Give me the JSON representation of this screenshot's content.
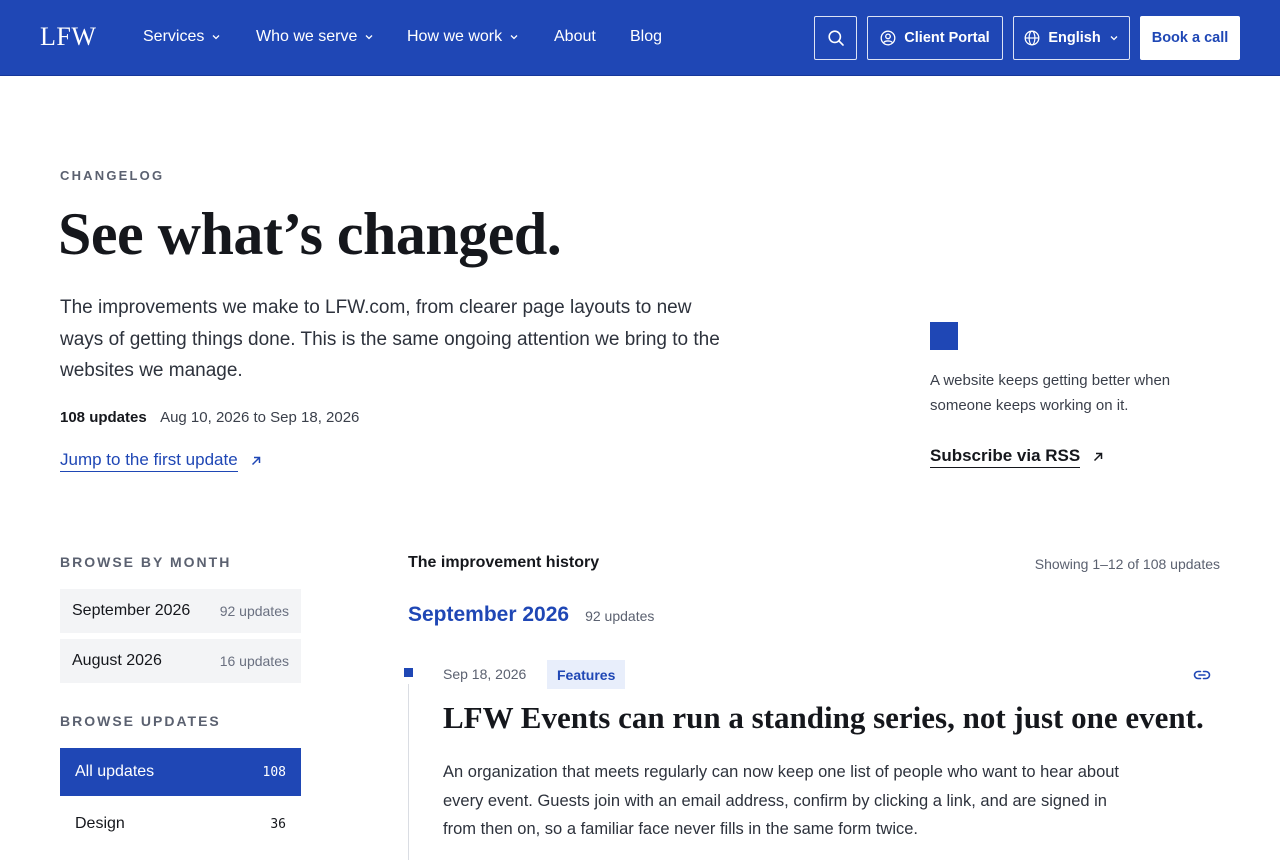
{
  "header": {
    "logo": "LFW",
    "nav": [
      {
        "label": "Services",
        "has_dropdown": true
      },
      {
        "label": "Who we serve",
        "has_dropdown": true
      },
      {
        "label": "How we work",
        "has_dropdown": true
      },
      {
        "label": "About",
        "has_dropdown": false
      },
      {
        "label": "Blog",
        "has_dropdown": false
      }
    ],
    "search_icon": "search-icon",
    "client_portal": "Client Portal",
    "language": "English",
    "book_call": "Book a call",
    "brand_color": "#1f47b5"
  },
  "hero": {
    "eyebrow": "CHANGELOG",
    "title": "See what’s changed.",
    "description": "The improvements we make to LFW.com, from clearer page layouts to new ways of getting things done. This is the same ongoing attention we bring to the websites we manage.",
    "update_count": "108 updates",
    "date_range": "Aug 10, 2026 to Sep 18, 2026",
    "jump_link": "Jump to the first update",
    "aside_text": "A website keeps getting better when someone keeps working on it.",
    "rss_link": "Subscribe via RSS"
  },
  "sidebar": {
    "browse_month_heading": "BROWSE BY MONTH",
    "months": [
      {
        "label": "September 2026",
        "count": "92 updates"
      },
      {
        "label": "August 2026",
        "count": "16 updates"
      }
    ],
    "browse_updates_heading": "BROWSE UPDATES",
    "categories": [
      {
        "label": "All updates",
        "count": "108",
        "active": true
      },
      {
        "label": "Design",
        "count": "36",
        "active": false
      }
    ]
  },
  "history": {
    "title": "The improvement history",
    "showing": "Showing 1–12 of 108 updates",
    "month_label": "September 2026",
    "month_count": "92 updates",
    "entry": {
      "date": "Sep 18, 2026",
      "tag": "Features",
      "title": "LFW Events can run a standing series, not just one event.",
      "body": "An organization that meets regularly can now keep one list of people who want to hear about every event. Guests join with an email address, confirm by clicking a link, and are signed in from then on, so a familiar face never fills in the same form twice."
    }
  }
}
